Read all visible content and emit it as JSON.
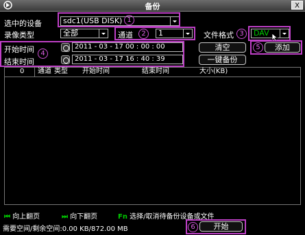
{
  "window": {
    "title": "备份",
    "close_label": "X"
  },
  "device": {
    "label": "选中的设备",
    "value": "sdc1(USB DISK)"
  },
  "record_type": {
    "label": "录像类型",
    "value": "全部"
  },
  "channel": {
    "label": "通道",
    "value": "1"
  },
  "file_format": {
    "label": "文件格式",
    "value": "DAV"
  },
  "start_time": {
    "label": "开始时间",
    "value": "2011 - 03 - 17    00 : 00 : 00"
  },
  "end_time": {
    "label": "结束时间",
    "value": "2011 - 03 - 17    16 : 40 : 39"
  },
  "buttons": {
    "clear": "清空",
    "add": "添加",
    "one_click_backup": "一键备份",
    "start": "开始"
  },
  "table": {
    "count": "0",
    "columns": [
      "通道",
      "类型",
      "开始时间",
      "结束时间",
      "大小(KB)"
    ]
  },
  "footer": {
    "page_up": "向上翻页",
    "page_down": "向下翻页",
    "select_hint": "选择/取消待备份设备或文件",
    "fn_key": "Fn",
    "space_label": "需要空间/剩余空间:0.00 KB/872.00 MB"
  },
  "annotations": [
    "1",
    "2",
    "3",
    "4",
    "5",
    "6"
  ],
  "colors": {
    "highlight": "#c040c8",
    "accent_green": "#00cc00",
    "background": "#000000"
  }
}
